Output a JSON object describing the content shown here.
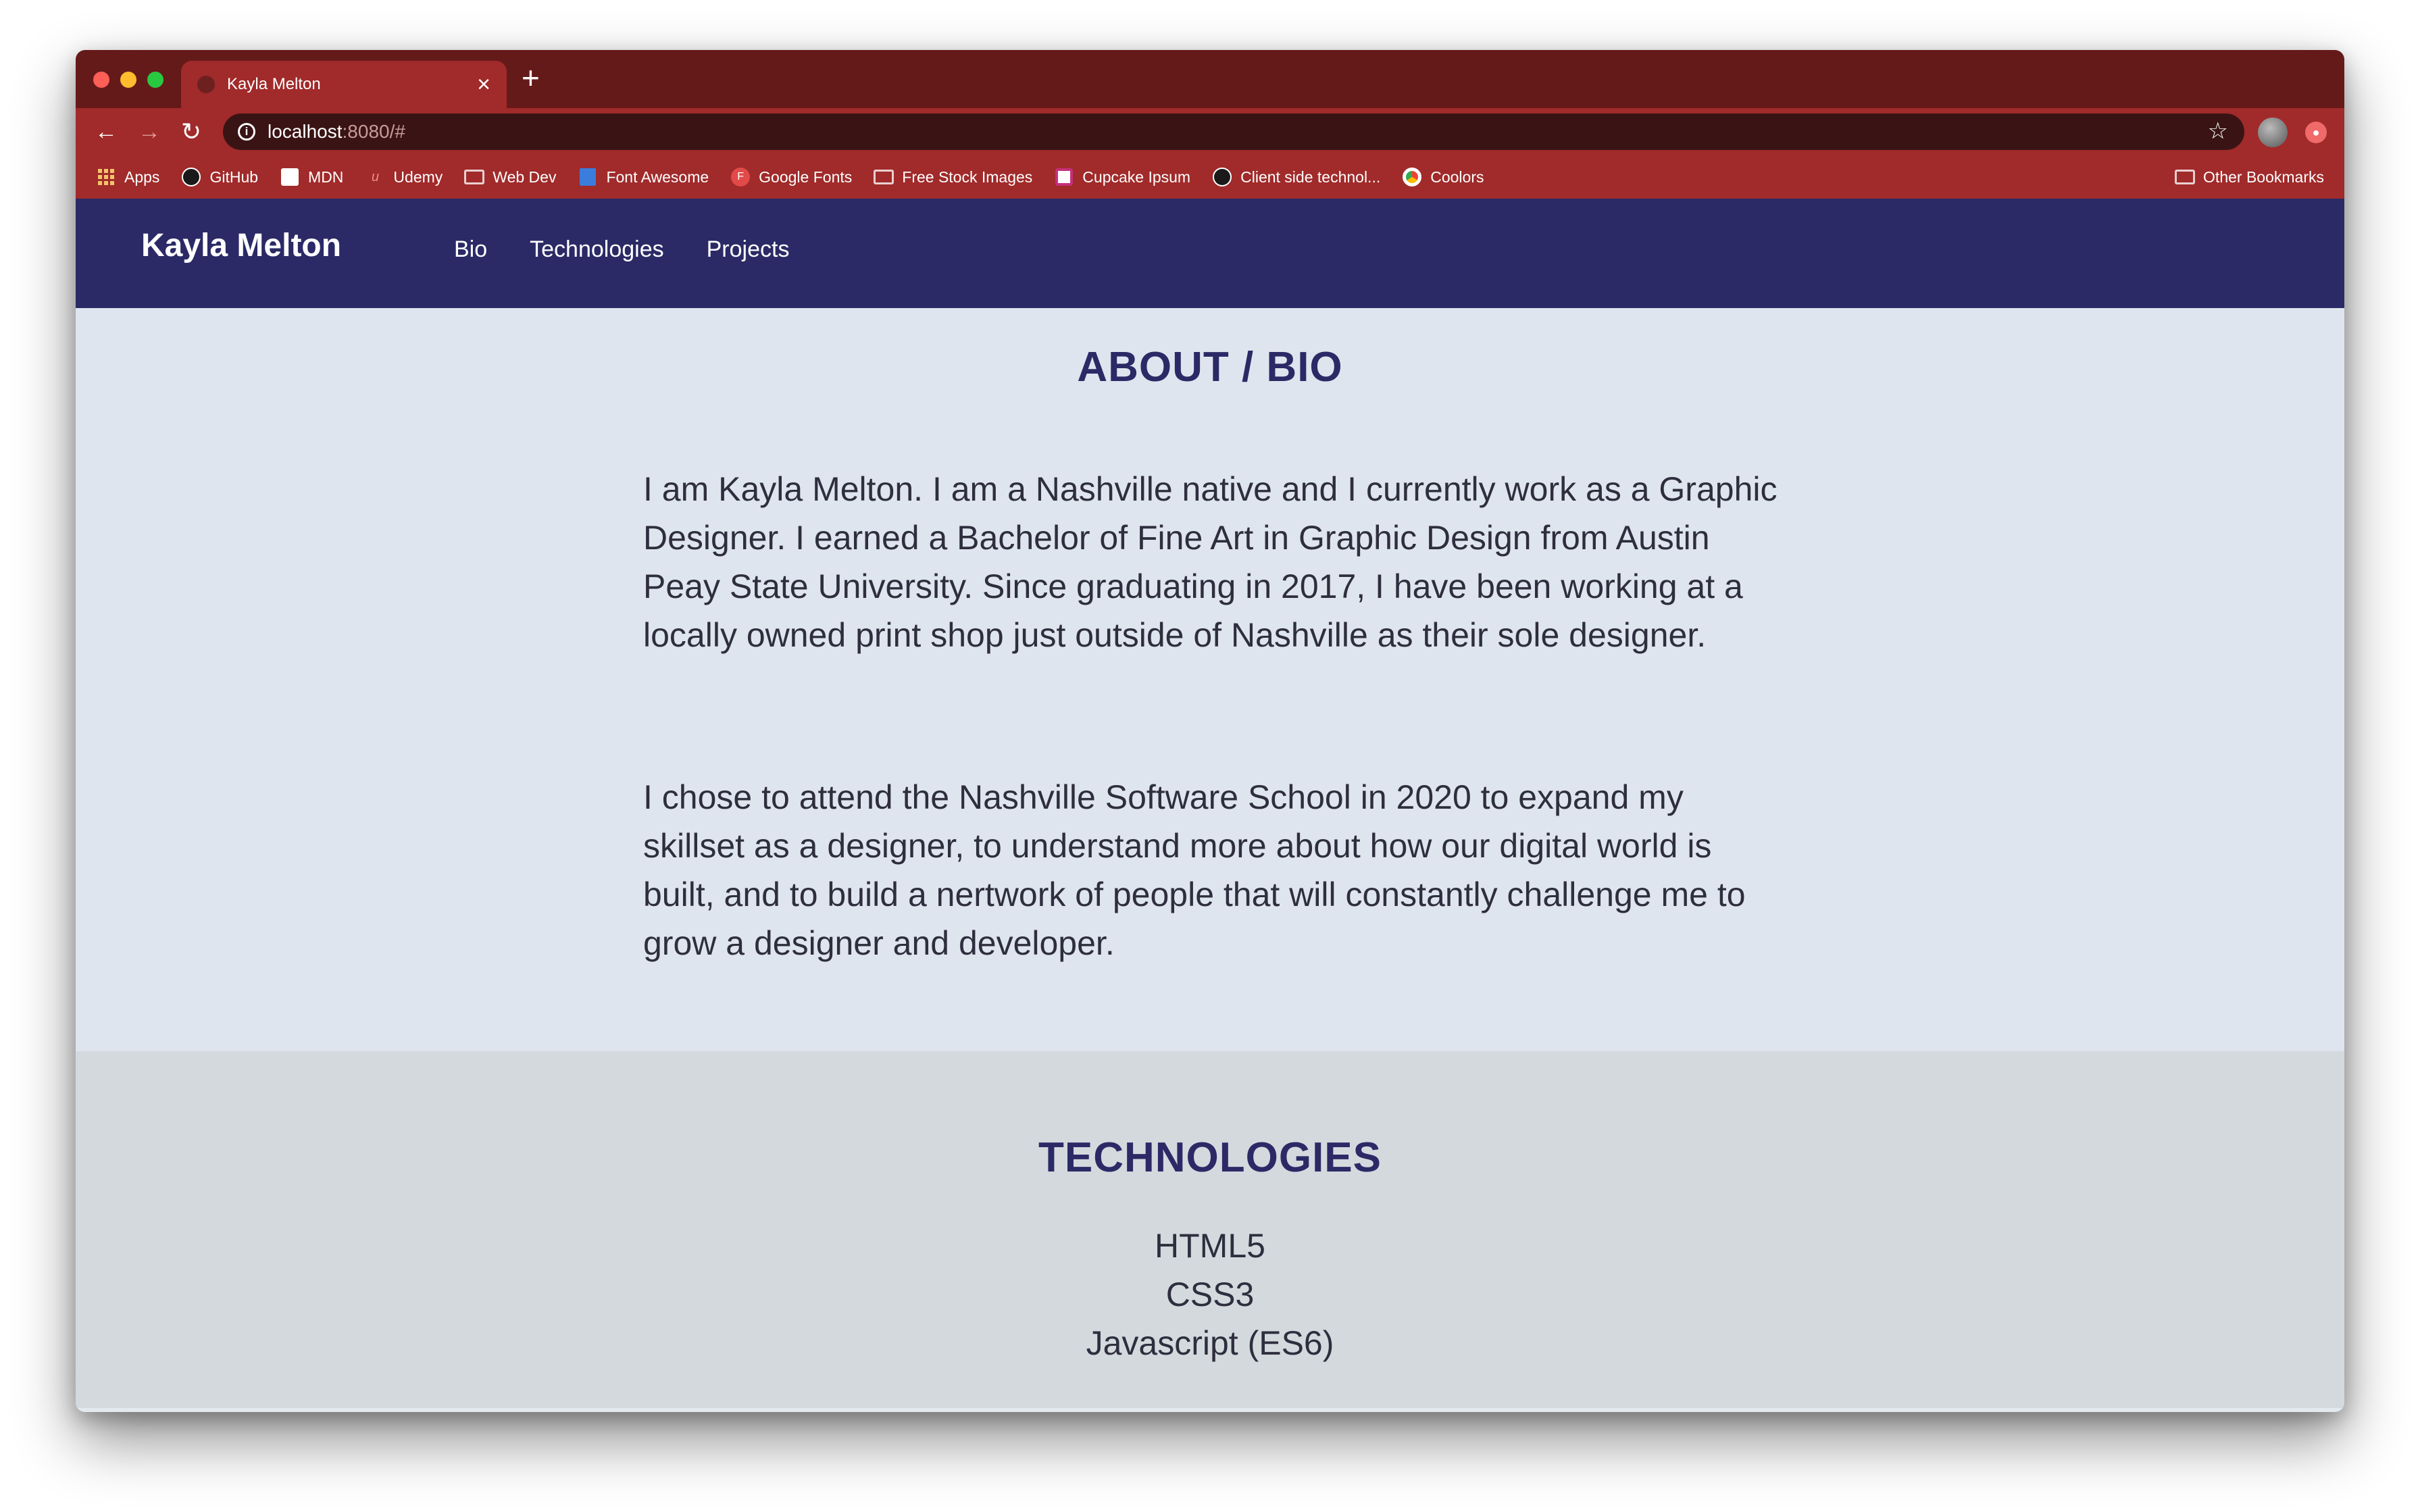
{
  "browser": {
    "tab_title": "Kayla Melton",
    "url_host": "localhost",
    "url_rest": ":8080/#",
    "bookmarks": [
      {
        "label": "Apps",
        "icon": "apps-grid-icon"
      },
      {
        "label": "GitHub",
        "icon": "github-icon"
      },
      {
        "label": "MDN",
        "icon": "mdn-icon"
      },
      {
        "label": "Udemy",
        "icon": "udemy-icon"
      },
      {
        "label": "Web Dev",
        "icon": "folder-icon"
      },
      {
        "label": "Font Awesome",
        "icon": "flag-icon"
      },
      {
        "label": "Google Fonts",
        "icon": "google-fonts-icon"
      },
      {
        "label": "Free Stock Images",
        "icon": "folder-icon"
      },
      {
        "label": "Cupcake Ipsum",
        "icon": "cupcake-icon"
      },
      {
        "label": "Client side technol...",
        "icon": "github-icon"
      },
      {
        "label": "Coolors",
        "icon": "chrome-icon"
      }
    ],
    "other_bookmarks": "Other Bookmarks"
  },
  "site": {
    "brand": "Kayla Melton",
    "nav": [
      "Bio",
      "Technologies",
      "Projects"
    ]
  },
  "bio": {
    "heading": "ABOUT / BIO",
    "paragraphs": [
      "I am Kayla Melton. I am a Nashville native and I currently work as a Graphic Designer. I earned a Bachelor of Fine Art in Graphic Design from Austin Peay State University. Since graduating in 2017, I have been working at a locally owned print shop just outside of Nashville as their sole designer.",
      "I chose to attend the Nashville Software School in 2020 to expand my skillset as a designer, to understand more about how our digital world is built, and to build a nertwork of people that will constantly challenge me to grow a designer and developer."
    ]
  },
  "technologies": {
    "heading": "TECHNOLOGIES",
    "items": [
      "HTML5",
      "CSS3",
      "Javascript (ES6)"
    ]
  },
  "colors": {
    "browser_frame": "#a12a2a",
    "navbar": "#2b2a66",
    "bio_bg": "#dfe5ee",
    "tech_bg": "#d4d9de",
    "card": "#6b9cac"
  }
}
